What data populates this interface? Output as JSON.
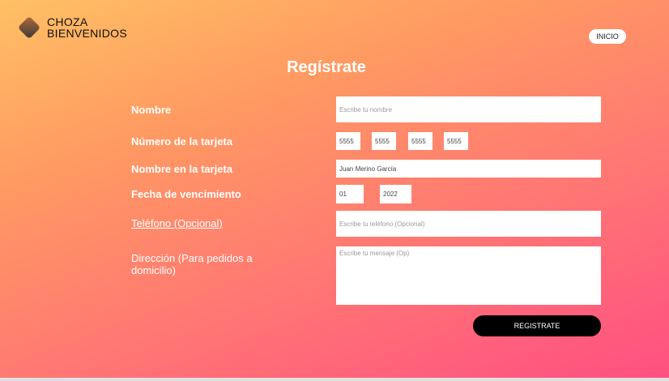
{
  "brand": {
    "line1": "CHOZA",
    "line2": "BIENVENIDOS"
  },
  "nav": {
    "inicio": "INICIO"
  },
  "page_title": "Regístrate",
  "form": {
    "nombre": {
      "label": "Nombre",
      "placeholder": "Escribe tu nombre"
    },
    "tarjeta": {
      "label": "Número de la tarjeta",
      "values": [
        "5555",
        "5555",
        "5555",
        "5555"
      ]
    },
    "nombre_tarjeta": {
      "label": "Nombre en la tarjeta",
      "value": "Juan Merino García"
    },
    "vencimiento": {
      "label": "Fecha de vencimiento",
      "month": "01",
      "year": "2022"
    },
    "telefono": {
      "label": "Teléfono (Opcional)",
      "placeholder": "Escribe tu teléfono (Opcional)"
    },
    "direccion": {
      "label": "Dirección (Para pedidos a domicilio)",
      "placeholder": "Escribe tu mensaje (Op)"
    },
    "submit": "REGISTRATE"
  }
}
